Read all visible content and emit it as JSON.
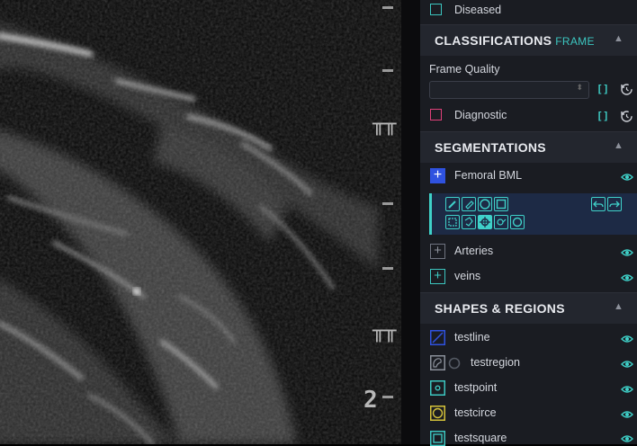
{
  "panel": {
    "top_item": {
      "label": "Diseased",
      "color": "#3cc6c0"
    },
    "classifications": {
      "title": "CLASSIFICATIONS",
      "subtitle": "FRAME",
      "frame_quality_label": "Frame Quality",
      "frame_quality_value": "",
      "diagnostic_label": "Diagnostic",
      "diagnostic_color": "#e0407a",
      "bracket_label": "[ ]"
    },
    "segmentations": {
      "title": "SEGMENTATIONS",
      "items": [
        {
          "label": "Femoral BML",
          "active": true,
          "color": "#2f52e0"
        },
        {
          "label": "Arteries",
          "active": false,
          "color": "#6f7480"
        },
        {
          "label": "veins",
          "active": false,
          "color": "#3cc6c0"
        }
      ]
    },
    "shapes": {
      "title": "SHAPES & REGIONS",
      "items": [
        {
          "label": "testline",
          "icon": "line-icon",
          "color": "#2f52e0"
        },
        {
          "label": "testregion",
          "icon": "region-icon",
          "color": "#8a8f99"
        },
        {
          "label": "testpoint",
          "icon": "point-icon",
          "color": "#3cc6c0"
        },
        {
          "label": "testcirce",
          "icon": "circle-icon",
          "color": "#d4c23a"
        },
        {
          "label": "testsquare",
          "icon": "square-icon",
          "color": "#3cc6c0"
        }
      ]
    }
  },
  "viewer": {
    "depth_label": "2"
  },
  "colors": {
    "accent": "#3fd1c9",
    "eye": "#3fd1c9",
    "panel_bg": "#1a1c22",
    "section_bg": "#23262e",
    "toolbar_bg": "#1d2a45"
  }
}
